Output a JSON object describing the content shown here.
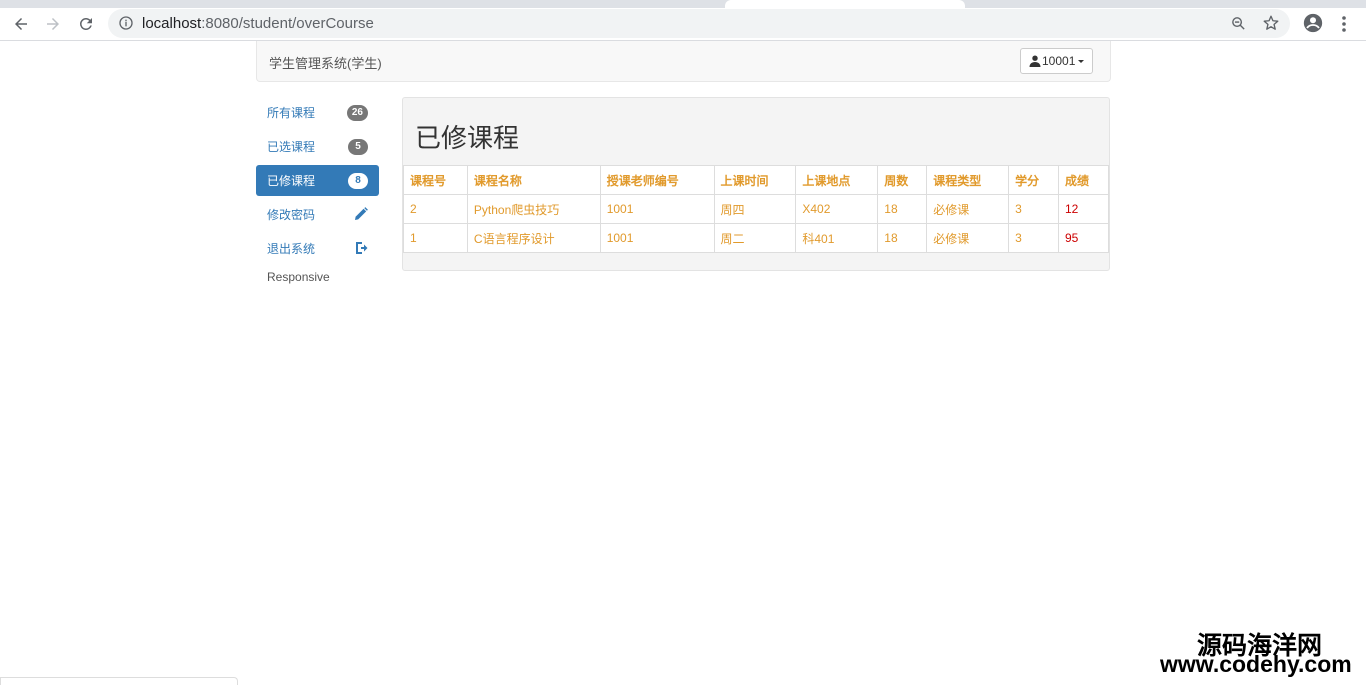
{
  "browser": {
    "url_host": "localhost",
    "url_rest": ":8080/student/overCourse"
  },
  "navbar": {
    "brand": "学生管理系统(学生)",
    "user": "10001"
  },
  "sidebar": {
    "items": [
      {
        "label": "所有课程",
        "badge": "26"
      },
      {
        "label": "已选课程",
        "badge": "5"
      },
      {
        "label": "已修课程",
        "badge": "8"
      },
      {
        "label": "修改密码",
        "icon": "pencil-icon"
      },
      {
        "label": "退出系统",
        "icon": "logout-icon"
      }
    ],
    "footer": "Responsive"
  },
  "main": {
    "title": "已修课程",
    "columns": [
      "课程号",
      "课程名称",
      "授课老师编号",
      "上课时间",
      "上课地点",
      "周数",
      "课程类型",
      "学分",
      "成绩"
    ],
    "rows": [
      [
        "2",
        "Python爬虫技巧",
        "1001",
        "周四",
        "X402",
        "18",
        "必修课",
        "3",
        "12"
      ],
      [
        "1",
        "C语言程序设计",
        "1001",
        "周二",
        "科401",
        "18",
        "必修课",
        "3",
        "95"
      ]
    ]
  },
  "watermark": {
    "line1": "源码海洋网",
    "line2": "www.codehy.com"
  },
  "colors": {
    "primary": "#337ab7",
    "table_text": "#e19a2c",
    "score": "#cc0000"
  }
}
